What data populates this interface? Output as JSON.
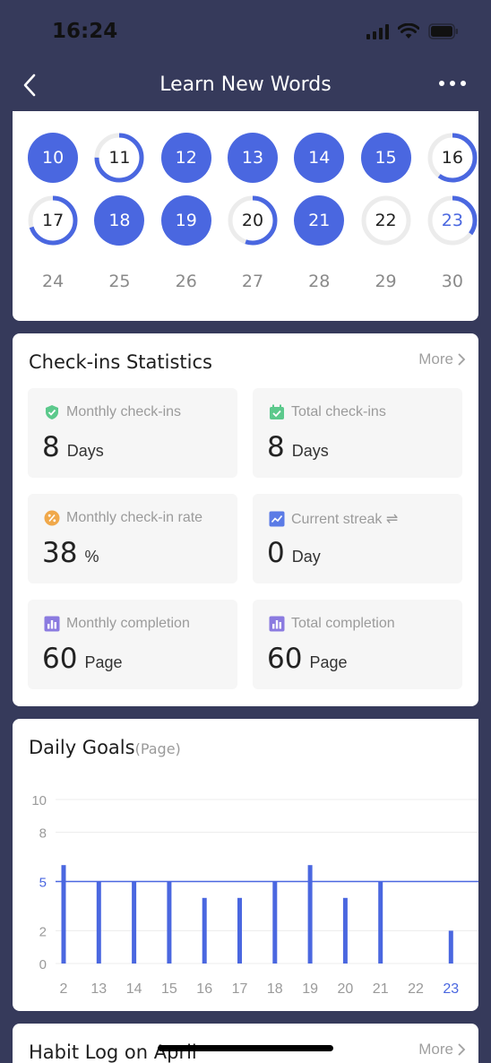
{
  "status": {
    "time": "16:24"
  },
  "nav": {
    "title": "Learn New Words"
  },
  "calendar": {
    "rows": [
      [
        {
          "day": "10",
          "style": "full",
          "progress": 1
        },
        {
          "day": "11",
          "style": "ring",
          "progress": 0.75
        },
        {
          "day": "12",
          "style": "full",
          "progress": 1
        },
        {
          "day": "13",
          "style": "full",
          "progress": 1
        },
        {
          "day": "14",
          "style": "full",
          "progress": 1
        },
        {
          "day": "15",
          "style": "full",
          "progress": 1
        },
        {
          "day": "16",
          "style": "ring",
          "progress": 0.6
        }
      ],
      [
        {
          "day": "17",
          "style": "ring",
          "progress": 0.7
        },
        {
          "day": "18",
          "style": "full",
          "progress": 1
        },
        {
          "day": "19",
          "style": "full",
          "progress": 1
        },
        {
          "day": "20",
          "style": "ring",
          "progress": 0.55
        },
        {
          "day": "21",
          "style": "full",
          "progress": 1
        },
        {
          "day": "22",
          "style": "ring",
          "progress": 0
        },
        {
          "day": "23",
          "style": "ring-today",
          "progress": 0.35
        }
      ],
      [
        {
          "day": "24",
          "style": "plain"
        },
        {
          "day": "25",
          "style": "plain"
        },
        {
          "day": "26",
          "style": "plain"
        },
        {
          "day": "27",
          "style": "plain"
        },
        {
          "day": "28",
          "style": "plain"
        },
        {
          "day": "29",
          "style": "plain"
        },
        {
          "day": "30",
          "style": "plain"
        }
      ]
    ]
  },
  "stats": {
    "title": "Check-ins Statistics",
    "more": "More",
    "items": [
      {
        "label": "Monthly check-ins",
        "value": "8",
        "unit": "Days",
        "icon": "check-shield-icon",
        "color": "#5cc98c"
      },
      {
        "label": "Total check-ins",
        "value": "8",
        "unit": "Days",
        "icon": "calendar-check-icon",
        "color": "#5cc98c"
      },
      {
        "label": "Monthly check-in rate",
        "value": "38",
        "unit": "%",
        "icon": "percent-icon",
        "color": "#f0a84a"
      },
      {
        "label": "Current streak ⇌",
        "value": "0",
        "unit": "Day",
        "icon": "trend-icon",
        "color": "#5b7be6"
      },
      {
        "label": "Monthly completion",
        "value": "60",
        "unit": "Page",
        "icon": "bar-chart-icon",
        "color": "#8b7be0"
      },
      {
        "label": "Total completion",
        "value": "60",
        "unit": "Page",
        "icon": "bar-chart-icon",
        "color": "#8b7be0"
      }
    ]
  },
  "goals": {
    "title": "Daily Goals",
    "unit": "(Page)"
  },
  "chart_data": {
    "type": "bar",
    "categories": [
      "2",
      "13",
      "14",
      "15",
      "16",
      "17",
      "18",
      "19",
      "20",
      "21",
      "22",
      "23"
    ],
    "values": [
      6,
      5,
      5,
      5,
      4,
      4,
      5,
      6,
      4,
      5,
      0,
      2
    ],
    "yticks": [
      "0",
      "2",
      "5",
      "8",
      "10"
    ],
    "ylim": [
      0,
      10
    ],
    "goal_line": 5,
    "highlight_category": "23",
    "bar_color": "#4a67e0"
  },
  "habit": {
    "title": "Habit Log on April",
    "more": "More"
  },
  "colors": {
    "accent": "#4a67e0",
    "background": "#363a5b"
  }
}
